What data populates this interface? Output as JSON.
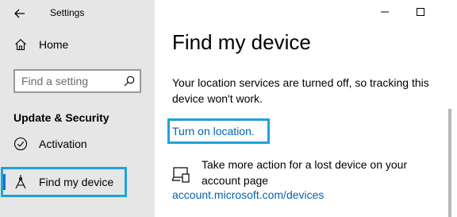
{
  "window": {
    "title": "Settings"
  },
  "sidebar": {
    "home_label": "Home",
    "search": {
      "placeholder": "Find a setting"
    },
    "section_title": "Update & Security",
    "items": [
      {
        "label": "Activation",
        "icon": "activation-check-icon"
      },
      {
        "label": "Find my device",
        "icon": "find-my-device-icon",
        "selected": true
      }
    ]
  },
  "main": {
    "title": "Find my device",
    "description": "Your location services are turned off, so tracking this device won't work.",
    "turn_on_location_link": "Turn on location.",
    "lost_device_text": "Take more action for a lost device on your account page",
    "account_link": "account.microsoft.com/devices"
  },
  "colors": {
    "accent": "#0078d7",
    "link": "#0063b1",
    "highlight_border": "#1fa3d8",
    "sidebar_bg": "#e6e6e6"
  }
}
